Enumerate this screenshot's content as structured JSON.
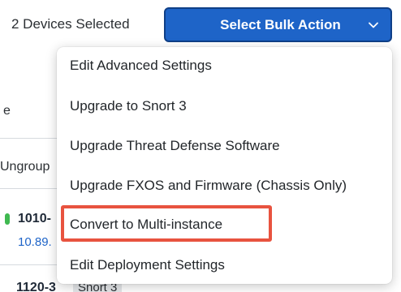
{
  "toolbar": {
    "selection_count": "2 Devices Selected",
    "bulk_action_label": "Select Bulk Action",
    "bulk_action_icon": "chevron-down-icon"
  },
  "colors": {
    "primary": "#1e64c8",
    "highlight": "#e8533f",
    "status_online": "#3fb950"
  },
  "background_table": {
    "header_fragment": "e",
    "group_fragment": "Ungroup",
    "rows": [
      {
        "name": "1010-",
        "ip": "10.89."
      },
      {
        "name": "1120-3",
        "tag": "Snort 3"
      }
    ]
  },
  "menu": {
    "items": [
      {
        "label": "Edit Advanced Settings"
      },
      {
        "label": "Upgrade to Snort 3"
      },
      {
        "label": "Upgrade Threat Defense Software"
      },
      {
        "label": "Upgrade FXOS and Firmware (Chassis Only)"
      },
      {
        "label": "Convert to Multi-instance",
        "highlighted": true
      },
      {
        "label": "Edit Deployment Settings"
      }
    ]
  }
}
